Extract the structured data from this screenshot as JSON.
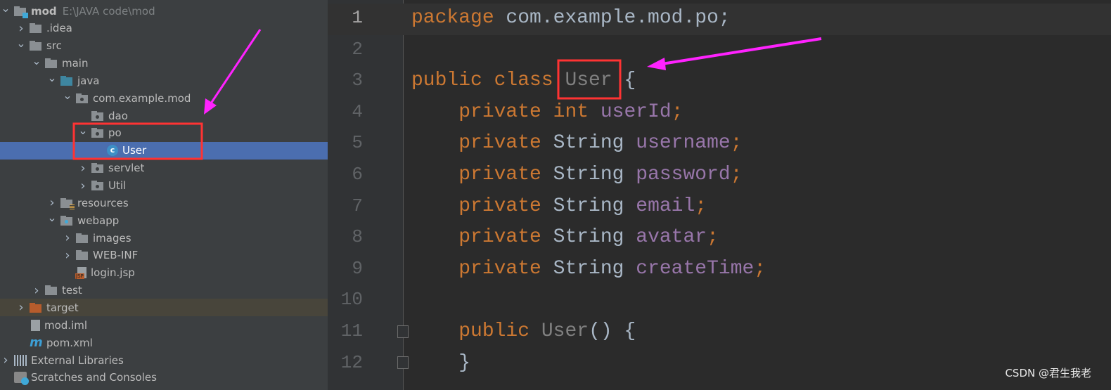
{
  "project_tree": [
    {
      "label": "mod",
      "path": "E:\\JAVA code\\mod",
      "level": 0,
      "arrow": "down",
      "icon": "module-folder-icon",
      "bold": true
    },
    {
      "label": ".idea",
      "level": 1,
      "arrow": "right",
      "icon": "folder-icon"
    },
    {
      "label": "src",
      "level": 1,
      "arrow": "down",
      "icon": "folder-icon"
    },
    {
      "label": "main",
      "level": 2,
      "arrow": "down",
      "icon": "folder-icon"
    },
    {
      "label": "java",
      "level": 3,
      "arrow": "down",
      "icon": "source-folder-icon"
    },
    {
      "label": "com.example.mod",
      "level": 4,
      "arrow": "down",
      "icon": "package-icon"
    },
    {
      "label": "dao",
      "level": 5,
      "arrow": "",
      "icon": "package-icon"
    },
    {
      "label": "po",
      "level": 5,
      "arrow": "down",
      "icon": "package-icon"
    },
    {
      "label": "User",
      "level": 6,
      "arrow": "",
      "icon": "class-icon",
      "selected": true
    },
    {
      "label": "servlet",
      "level": 5,
      "arrow": "right",
      "icon": "package-icon"
    },
    {
      "label": "Util",
      "level": 5,
      "arrow": "right",
      "icon": "package-icon"
    },
    {
      "label": "resources",
      "level": 3,
      "arrow": "right",
      "icon": "resources-folder-icon"
    },
    {
      "label": "webapp",
      "level": 3,
      "arrow": "down",
      "icon": "web-folder-icon"
    },
    {
      "label": "images",
      "level": 4,
      "arrow": "right",
      "icon": "folder-icon"
    },
    {
      "label": "WEB-INF",
      "level": 4,
      "arrow": "right",
      "icon": "folder-icon"
    },
    {
      "label": "login.jsp",
      "level": 4,
      "arrow": "",
      "icon": "jsp-file-icon"
    },
    {
      "label": "test",
      "level": 2,
      "arrow": "right",
      "icon": "folder-icon"
    },
    {
      "label": "target",
      "level": 1,
      "arrow": "right",
      "icon": "excluded-folder-icon",
      "excluded": true
    },
    {
      "label": "mod.iml",
      "level": 1,
      "arrow": "",
      "icon": "iml-file-icon"
    },
    {
      "label": "pom.xml",
      "level": 1,
      "arrow": "",
      "icon": "maven-icon"
    },
    {
      "label": "External Libraries",
      "level": 0,
      "arrow": "right",
      "icon": "libraries-icon"
    },
    {
      "label": "Scratches and Consoles",
      "level": 0,
      "arrow": "",
      "icon": "scratches-icon"
    }
  ],
  "editor": {
    "current_line": 1,
    "lines": [
      {
        "n": "1",
        "tokens": [
          [
            "kw",
            "package "
          ],
          [
            "pl",
            "com.example.mod.po;"
          ]
        ]
      },
      {
        "n": "2",
        "tokens": []
      },
      {
        "n": "3",
        "tokens": [
          [
            "kw",
            "public class "
          ],
          [
            "un",
            "User"
          ],
          [
            "pl",
            " {"
          ]
        ]
      },
      {
        "n": "4",
        "tokens": [
          [
            "pl",
            "    "
          ],
          [
            "kw",
            "private int "
          ],
          [
            "fld",
            "userId"
          ],
          [
            "kw",
            ";"
          ]
        ]
      },
      {
        "n": "5",
        "tokens": [
          [
            "pl",
            "    "
          ],
          [
            "kw",
            "private "
          ],
          [
            "pl",
            "String "
          ],
          [
            "fld",
            "username"
          ],
          [
            "kw",
            ";"
          ]
        ]
      },
      {
        "n": "6",
        "tokens": [
          [
            "pl",
            "    "
          ],
          [
            "kw",
            "private "
          ],
          [
            "pl",
            "String "
          ],
          [
            "fld",
            "password"
          ],
          [
            "kw",
            ";"
          ]
        ]
      },
      {
        "n": "7",
        "tokens": [
          [
            "pl",
            "    "
          ],
          [
            "kw",
            "private "
          ],
          [
            "pl",
            "String "
          ],
          [
            "fld",
            "email"
          ],
          [
            "kw",
            ";"
          ]
        ]
      },
      {
        "n": "8",
        "tokens": [
          [
            "pl",
            "    "
          ],
          [
            "kw",
            "private "
          ],
          [
            "pl",
            "String "
          ],
          [
            "fld",
            "avatar"
          ],
          [
            "kw",
            ";"
          ]
        ]
      },
      {
        "n": "9",
        "tokens": [
          [
            "pl",
            "    "
          ],
          [
            "kw",
            "private "
          ],
          [
            "pl",
            "String "
          ],
          [
            "fld",
            "createTime"
          ],
          [
            "kw",
            ";"
          ]
        ]
      },
      {
        "n": "10",
        "tokens": []
      },
      {
        "n": "11",
        "tokens": [
          [
            "pl",
            "    "
          ],
          [
            "kw",
            "public "
          ],
          [
            "un",
            "User"
          ],
          [
            "pl",
            "() {"
          ]
        ]
      },
      {
        "n": "12",
        "tokens": [
          [
            "pl",
            "    }"
          ]
        ]
      }
    ]
  },
  "colors": {
    "keyword": "#cc7832",
    "field": "#9876aa",
    "unused": "#808080",
    "plain": "#a9b7c6",
    "selection": "#4b6eaf",
    "annotation_box": "#ff3333",
    "annotation_arrow": "#ff22ff"
  },
  "watermark": "CSDN @君生我老"
}
